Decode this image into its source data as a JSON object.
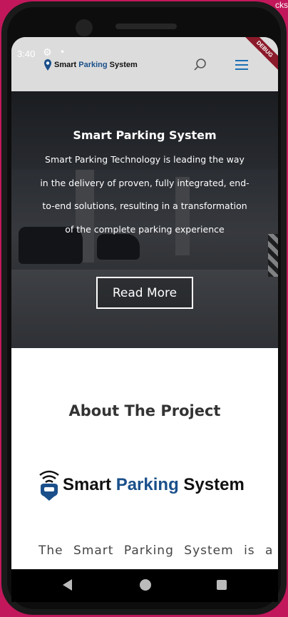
{
  "background": {
    "cut_text": "cks"
  },
  "status_bar": {
    "time": "3:40"
  },
  "header": {
    "logo_text_1": "Smart ",
    "logo_text_2": "Parking",
    "logo_text_3": " System",
    "debug_banner": "DEBUG"
  },
  "hero": {
    "title": "Smart Parking System",
    "text": "Smart Parking Technology is leading the way in the delivery of proven, fully integrated, end-to-end solutions, resulting in a transformation of the complete parking experience",
    "button_label": "Read More"
  },
  "about": {
    "title": "About The Project",
    "logo_text_1": "Smart ",
    "logo_text_2": "Parking",
    "logo_text_3": " System",
    "text": "The Smart Parking System is a"
  },
  "colors": {
    "brand_blue": "#1a4f8a",
    "accent_pink": "#c2185b"
  }
}
